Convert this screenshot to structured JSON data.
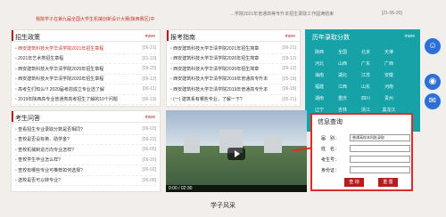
{
  "top_news": [
    {
      "text": "我院学子在第九届全国大学生机械创新设计大赛(陕西赛区)中",
      "date": "",
      "style": "red"
    },
    {
      "text": "…学院2021年普通高等专升本招生录取工作圆满结束",
      "date": "[21-06-20]",
      "style": "gray"
    }
  ],
  "admission_policy": {
    "title": "招生政策",
    "more": "more",
    "items": [
      {
        "text": "西安建筑科技大学华清学院2021年招生章程",
        "date": "[06-21]",
        "highlight": true
      },
      {
        "text": "2021年艺术类招生章程",
        "date": "[01-10]",
        "highlight": false
      },
      {
        "text": "西安建筑科技大学华清学院2020年招生章程",
        "date": "[09-25]",
        "highlight": false
      },
      {
        "text": "西安建筑科技大学华清学院2020年招生章程",
        "date": "[09-12]",
        "highlight": false
      },
      {
        "text": "高考生们知么!!! 2020届考前成立专业选了解",
        "date": "[06-11]",
        "highlight": false
      },
      {
        "text": "2019年陕西高专业普通类高考招生了解的10个问题",
        "date": "[06-19]",
        "highlight": false
      }
    ]
  },
  "exam_news": {
    "title": "报考指南",
    "more": "more",
    "items": [
      {
        "text": "西安建筑科技大学华清学院2021年招生简章",
        "date": "[06-21]"
      },
      {
        "text": "西安建筑科技大学华清学院2020年招生简章",
        "date": "[09-12]"
      },
      {
        "text": "西安建筑科技大学华清学院2020年招生简章",
        "date": "[09-12]"
      },
      {
        "text": "西安建筑科技大学华清学院2019年普通高专升本",
        "date": "[05-18]"
      },
      {
        "text": "西安建筑科技大学华清学院2019年普通高专升本",
        "date": "[06-18]"
      },
      {
        "text": "(一) 建筑系有哪些专业，了解一下?",
        "date": "[05-21]"
      }
    ]
  },
  "history_scores": {
    "title": "历年录取分数",
    "more": "more",
    "provinces": [
      "陕西",
      "全国",
      "北京",
      "天津",
      "河北",
      "山西",
      "广东",
      "广西",
      "海南",
      "湖北",
      "江苏",
      "安徽",
      "福建",
      "江西",
      "山东",
      "河南",
      "湖南",
      "重庆",
      "四川",
      "贵州",
      "辽宁",
      "吉林",
      "浙江",
      "黑龙江",
      "内蒙古",
      "新疆",
      "青海",
      "甘肃",
      "宁夏",
      "云南",
      "西藏",
      "上海"
    ]
  },
  "student_qa": {
    "title": "考生问答",
    "more": "more",
    "items": [
      {
        "text": "查看招生专业录取分数是否相同?",
        "date": "[06-03]"
      },
      {
        "text": "查校是否设有英、助学金?",
        "date": "[06-22]"
      },
      {
        "text": "查校机械制造方向专业怎样?",
        "date": "[06-05]"
      },
      {
        "text": "查校学生毕业怎么样?",
        "date": "[06-16]"
      },
      {
        "text": "查校有哪些专业可推荐如何选择?",
        "date": "[06-02]"
      },
      {
        "text": "送校是否可以转专业?",
        "date": "[06-08]"
      }
    ]
  },
  "video": {
    "time": "0:00 / 02:30"
  },
  "info_query": {
    "title": "信息查询",
    "year_label": "届　别：",
    "year_value": "普通高校本科批录取",
    "name_label": "姓　名：",
    "exam_no_label": "考生号：",
    "id_label": "身份证：",
    "search_button": "查 询",
    "reset_button": "重 置"
  },
  "footer": {
    "title": "学子风采"
  }
}
